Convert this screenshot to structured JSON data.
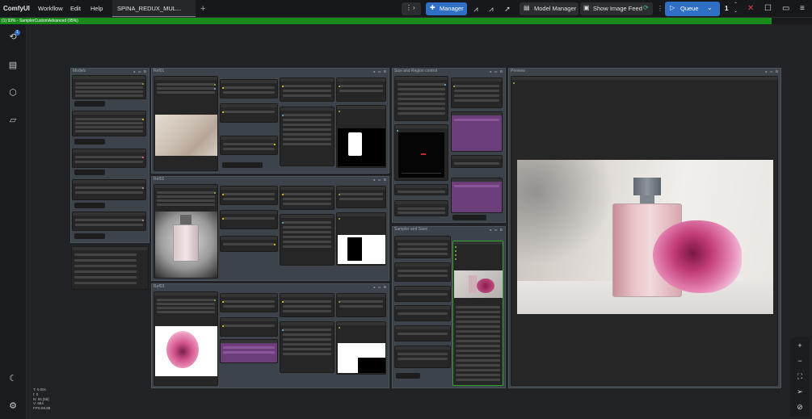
{
  "app": {
    "title": "ComfyUI"
  },
  "menu": [
    "Workflow",
    "Edit",
    "Help"
  ],
  "tab": {
    "label": "SPINA_REDUX_MUL..."
  },
  "toolbar": {
    "manager_label": "Manager",
    "model_manager_label": "Model Manager",
    "show_feed_label": "Show Image Feed",
    "queue_label": "Queue",
    "queue_count": "1"
  },
  "progress": {
    "text": "(1) 93% - SamplerCustomAdvanced (95%)",
    "fraction": 0.95,
    "color": "#1a8a1a"
  },
  "sidebar": {
    "icons": [
      "history-icon",
      "queue-list-icon",
      "model-library-icon",
      "workflows-folder-icon",
      "theme-moon-icon",
      "settings-gear-icon"
    ],
    "badge": "1"
  },
  "groups": {
    "models": "Models",
    "ref1": "Ref01",
    "ref2": "Ref02",
    "ref3": "Ref03",
    "size_region": "Size and Region control",
    "sampler_save": "Sampler and Save",
    "preview": "Preview"
  },
  "stats": [
    "T: 0.00s",
    "I: 0",
    "N: 55 [55]",
    "V: 684",
    "FPS:59.88"
  ],
  "canvas_tools": [
    "zoom-in-icon",
    "zoom-out-icon",
    "fit-view-icon",
    "select-mode-icon",
    "toggle-links-icon"
  ],
  "colors": {
    "accent": "#2f6fc5",
    "group_bg": "#3c434a",
    "node_bg": "#262626",
    "purple": "#6b3e7a"
  }
}
